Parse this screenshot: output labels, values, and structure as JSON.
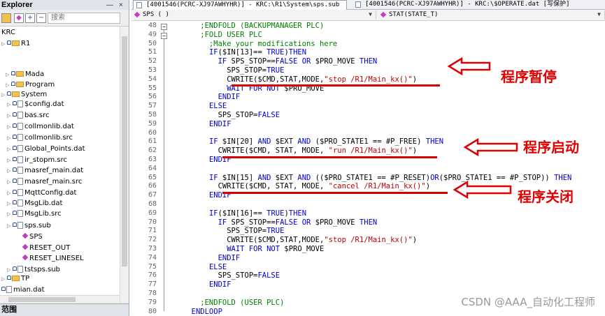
{
  "explorer": {
    "title": "Explorer",
    "pin": "—",
    "close": "×",
    "search_placeholder": "搜索",
    "tree": [
      {
        "label": "KRC",
        "type": "root"
      },
      {
        "label": "R1",
        "type": "folder"
      },
      {
        "label": "Mada",
        "type": "folder"
      },
      {
        "label": "Program",
        "type": "folder"
      },
      {
        "label": "System",
        "type": "folder"
      },
      {
        "label": "$config.dat",
        "type": "file"
      },
      {
        "label": "bas.src",
        "type": "file"
      },
      {
        "label": "collmonlib.dat",
        "type": "file"
      },
      {
        "label": "collmonlib.src",
        "type": "file"
      },
      {
        "label": "Global_Points.dat",
        "type": "file"
      },
      {
        "label": "ir_stopm.src",
        "type": "file"
      },
      {
        "label": "masref_main.dat",
        "type": "file"
      },
      {
        "label": "masref_main.src",
        "type": "file"
      },
      {
        "label": "MqttConfig.dat",
        "type": "file"
      },
      {
        "label": "MsgLib.dat",
        "type": "file"
      },
      {
        "label": "MsgLib.src",
        "type": "file"
      },
      {
        "label": "sps.sub",
        "type": "file"
      },
      {
        "label": "SPS",
        "type": "func"
      },
      {
        "label": "RESET_OUT",
        "type": "func"
      },
      {
        "label": "RESET_LINESEL",
        "type": "func"
      },
      {
        "label": "tstsps.sub",
        "type": "file"
      },
      {
        "label": "TP",
        "type": "folder"
      },
      {
        "label": "mian.dat",
        "type": "file"
      }
    ],
    "bottom_panel": "范围"
  },
  "tabs": [
    {
      "label": "[4001546(PCRC-XJ97AWHYHR)] - KRC:\\R1\\System\\sps.sub",
      "active": true
    },
    {
      "label": "[4001546(PCRC-XJ97AWHYHR)] - KRC:\\$OPERATE.dat [写保护]",
      "active": false
    }
  ],
  "combos": {
    "left": "SPS ( )",
    "right": "STAT(STATE_T)"
  },
  "editor": {
    "lines": [
      {
        "n": "48",
        "tokens": [
          [
            "cm",
            "    ;ENDFOLD (BACKUPMANAGER PLC)"
          ]
        ]
      },
      {
        "n": "49",
        "tokens": [
          [
            "cm",
            "    ;FOLD USER PLC"
          ]
        ]
      },
      {
        "n": "50",
        "tokens": [
          [
            "cm",
            "      ;Make your modifications here"
          ]
        ]
      },
      {
        "n": "51",
        "tokens": [
          [
            "nb",
            "      "
          ],
          [
            "kw",
            "IF"
          ],
          [
            "nb",
            "($IN[13]== "
          ],
          [
            "kw",
            "TRUE"
          ],
          [
            "nb",
            ")"
          ],
          [
            "kw",
            "THEN"
          ]
        ]
      },
      {
        "n": "52",
        "tokens": [
          [
            "nb",
            "        "
          ],
          [
            "kw",
            "IF"
          ],
          [
            "nb",
            " SPS_STOP=="
          ],
          [
            "kw",
            "FALSE"
          ],
          [
            "nb",
            " "
          ],
          [
            "kw",
            "OR"
          ],
          [
            "nb",
            " $PRO_MOVE "
          ],
          [
            "kw",
            "THEN"
          ]
        ]
      },
      {
        "n": "53",
        "tokens": [
          [
            "nb",
            "          SPS_STOP="
          ],
          [
            "kw",
            "TRUE"
          ]
        ]
      },
      {
        "n": "54",
        "tokens": [
          [
            "nb",
            "          CWRITE($CMD,STAT,MODE,"
          ],
          [
            "st",
            "\"stop /R1/Main_kx()\""
          ],
          [
            "nb",
            ")"
          ]
        ]
      },
      {
        "n": "55",
        "tokens": [
          [
            "nb",
            "          "
          ],
          [
            "kw",
            "WAIT FOR NOT"
          ],
          [
            "nb",
            " $PRO_MOVE"
          ]
        ]
      },
      {
        "n": "56",
        "tokens": [
          [
            "nb",
            "        "
          ],
          [
            "kw",
            "ENDIF"
          ]
        ]
      },
      {
        "n": "57",
        "tokens": [
          [
            "nb",
            "      "
          ],
          [
            "kw",
            "ELSE"
          ]
        ]
      },
      {
        "n": "58",
        "tokens": [
          [
            "nb",
            "        SPS_STOP="
          ],
          [
            "kw",
            "FALSE"
          ]
        ]
      },
      {
        "n": "59",
        "tokens": [
          [
            "nb",
            "      "
          ],
          [
            "kw",
            "ENDIF"
          ]
        ]
      },
      {
        "n": "60",
        "tokens": [
          [
            "nb",
            ""
          ]
        ]
      },
      {
        "n": "61",
        "tokens": [
          [
            "nb",
            "      "
          ],
          [
            "kw",
            "IF"
          ],
          [
            "nb",
            " $IN[20] "
          ],
          [
            "kw",
            "AND"
          ],
          [
            "nb",
            " $EXT "
          ],
          [
            "kw",
            "AND"
          ],
          [
            "nb",
            " ($PRO_STATE1 == #P_FREE) "
          ],
          [
            "kw",
            "THEN"
          ]
        ]
      },
      {
        "n": "62",
        "tokens": [
          [
            "nb",
            "        CWRITE($CMD, STAT, MODE, "
          ],
          [
            "st",
            "\"run /R1/Main_kx()\""
          ],
          [
            "nb",
            ")"
          ]
        ]
      },
      {
        "n": "63",
        "tokens": [
          [
            "nb",
            "      "
          ],
          [
            "kw",
            "ENDIF"
          ]
        ]
      },
      {
        "n": "64",
        "tokens": [
          [
            "nb",
            ""
          ]
        ]
      },
      {
        "n": "65",
        "tokens": [
          [
            "nb",
            "      "
          ],
          [
            "kw",
            "IF"
          ],
          [
            "nb",
            " $IN[15] "
          ],
          [
            "kw",
            "AND"
          ],
          [
            "nb",
            " $EXT "
          ],
          [
            "kw",
            "AND"
          ],
          [
            "nb",
            " (($PRO_STATE1 == #P_RESET)"
          ],
          [
            "kw",
            "OR"
          ],
          [
            "nb",
            "($PRO_STATE1 == #P_STOP)) "
          ],
          [
            "kw",
            "THEN"
          ]
        ]
      },
      {
        "n": "66",
        "tokens": [
          [
            "nb",
            "        CWRITE($CMD, STAT, MODE, "
          ],
          [
            "st",
            "\"cancel /R1/Main_kx()\""
          ],
          [
            "nb",
            ")"
          ]
        ]
      },
      {
        "n": "67",
        "tokens": [
          [
            "nb",
            "      "
          ],
          [
            "kw",
            "ENDIF"
          ]
        ]
      },
      {
        "n": "68",
        "tokens": [
          [
            "nb",
            ""
          ]
        ]
      },
      {
        "n": "69",
        "tokens": [
          [
            "nb",
            "      "
          ],
          [
            "kw",
            "IF"
          ],
          [
            "nb",
            "($IN[16]== "
          ],
          [
            "kw",
            "TRUE"
          ],
          [
            "nb",
            ")"
          ],
          [
            "kw",
            "THEN"
          ]
        ]
      },
      {
        "n": "70",
        "tokens": [
          [
            "nb",
            "        "
          ],
          [
            "kw",
            "IF"
          ],
          [
            "nb",
            " SPS_STOP=="
          ],
          [
            "kw",
            "FALSE"
          ],
          [
            "nb",
            " "
          ],
          [
            "kw",
            "OR"
          ],
          [
            "nb",
            " $PRO_MOVE "
          ],
          [
            "kw",
            "THEN"
          ]
        ]
      },
      {
        "n": "71",
        "tokens": [
          [
            "nb",
            "          SPS_STOP="
          ],
          [
            "kw",
            "TRUE"
          ]
        ]
      },
      {
        "n": "72",
        "tokens": [
          [
            "nb",
            "          CWRITE($CMD,STAT,MODE,"
          ],
          [
            "st",
            "\"stop /R1/Main_kx()\""
          ],
          [
            "nb",
            ")"
          ]
        ]
      },
      {
        "n": "73",
        "tokens": [
          [
            "nb",
            "          "
          ],
          [
            "kw",
            "WAIT FOR NOT"
          ],
          [
            "nb",
            " $PRO_MOVE"
          ]
        ]
      },
      {
        "n": "74",
        "tokens": [
          [
            "nb",
            "        "
          ],
          [
            "kw",
            "ENDIF"
          ]
        ]
      },
      {
        "n": "75",
        "tokens": [
          [
            "nb",
            "      "
          ],
          [
            "kw",
            "ELSE"
          ]
        ]
      },
      {
        "n": "76",
        "tokens": [
          [
            "nb",
            "        SPS_STOP="
          ],
          [
            "kw",
            "FALSE"
          ]
        ]
      },
      {
        "n": "77",
        "tokens": [
          [
            "nb",
            "      "
          ],
          [
            "kw",
            "ENDIF"
          ]
        ]
      },
      {
        "n": "78",
        "tokens": [
          [
            "nb",
            ""
          ]
        ]
      },
      {
        "n": "79",
        "tokens": [
          [
            "cm",
            "    ;ENDFOLD (USER PLC)"
          ]
        ]
      },
      {
        "n": "80",
        "tokens": [
          [
            "kw",
            "  ENDLOOP"
          ]
        ]
      }
    ]
  },
  "annotations": [
    {
      "label": "程序暂停"
    },
    {
      "label": "程序启动"
    },
    {
      "label": "程序关闭"
    }
  ],
  "colors": {
    "annotation": "#e00000",
    "keyword": "#0000c8",
    "string": "#c00000",
    "comment": "#008000"
  },
  "watermark": "CSDN @AAA_自动化工程师"
}
